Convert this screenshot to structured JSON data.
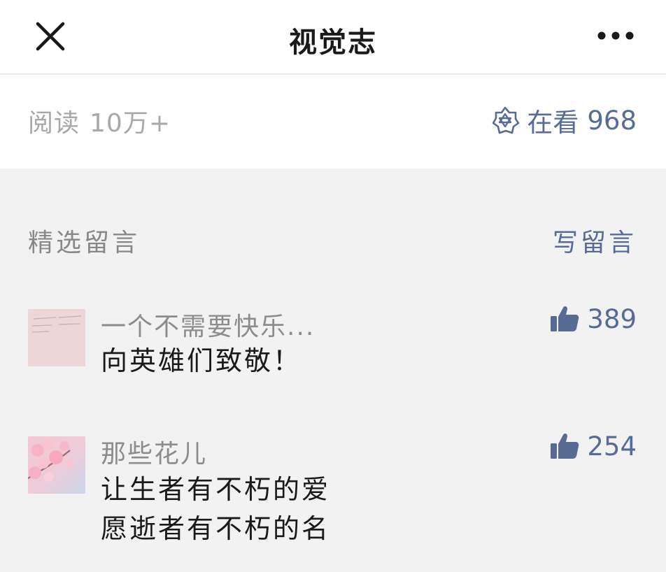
{
  "header": {
    "title": "视觉志",
    "close_icon": "close-icon",
    "more_icon": "more-dots-icon"
  },
  "stats": {
    "read_label": "阅读",
    "read_count": "10万+",
    "watch_label": "在看",
    "watch_count": "968",
    "watch_icon": "wow-star-icon"
  },
  "comments_section": {
    "title": "精选留言",
    "write_label": "写留言",
    "items": [
      {
        "nickname": "一个不需要快乐...",
        "lines": [
          "向英雄们致敬！"
        ],
        "likes": "389",
        "avatar_icon": "avatar-text-image"
      },
      {
        "nickname": "那些花儿",
        "lines": [
          "让生者有不朽的爱",
          "愿逝者有不朽的名"
        ],
        "likes": "254",
        "avatar_icon": "avatar-cherry-blossom"
      }
    ]
  },
  "colors": {
    "link": "#576b95",
    "muted": "#a8a8a8",
    "text": "#1a1a1a",
    "background": "#f2f2f2"
  }
}
